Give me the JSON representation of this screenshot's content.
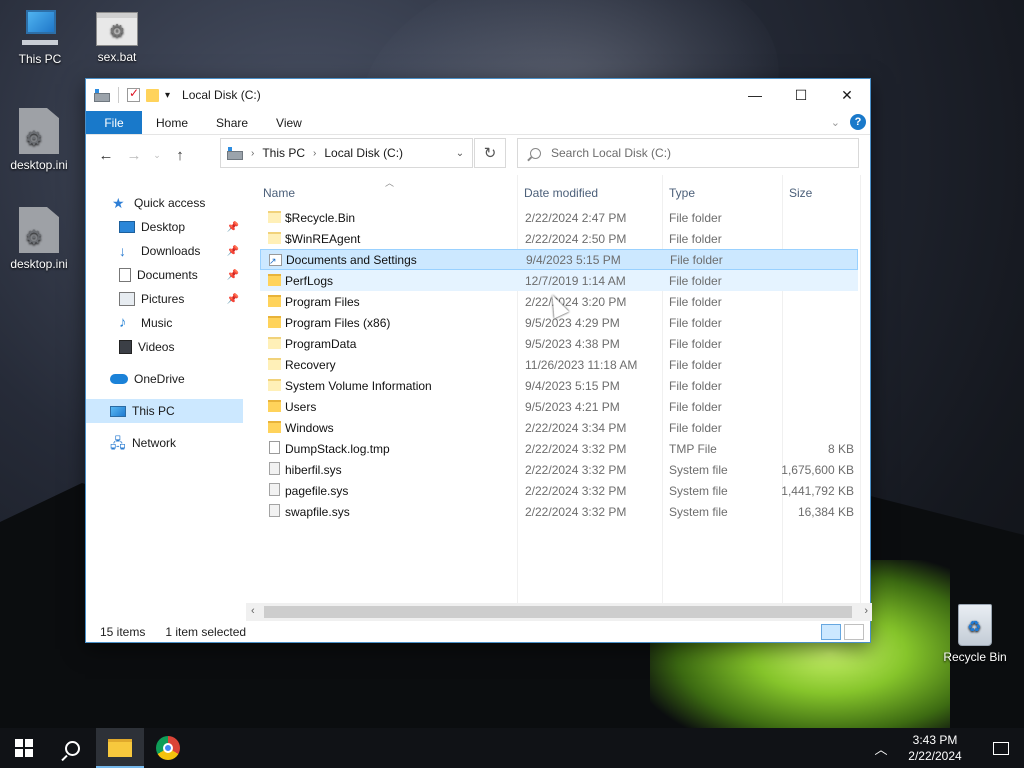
{
  "desktop": {
    "icons": [
      {
        "label": "This PC",
        "icon": "computer-icon"
      },
      {
        "label": "sex.bat",
        "icon": "batch-file-icon"
      },
      {
        "label": "desktop.ini",
        "icon": "settings-file-icon"
      },
      {
        "label": "desktop.ini",
        "icon": "settings-file-icon"
      },
      {
        "label": "Recycle Bin",
        "icon": "recycle-bin-icon"
      }
    ]
  },
  "window": {
    "title": "Local Disk (C:)",
    "controls": {
      "minimize": "—",
      "maximize": "☐",
      "close": "✕"
    }
  },
  "ribbon": {
    "tabs": [
      "File",
      "Home",
      "Share",
      "View"
    ],
    "help": "?"
  },
  "nav": {
    "address": [
      "This PC",
      "Local Disk (C:)"
    ],
    "search_placeholder": "Search Local Disk (C:)"
  },
  "sidebar": {
    "items": [
      {
        "label": "Quick access",
        "icon": "star-icon",
        "pinned": false
      },
      {
        "label": "Desktop",
        "icon": "desktop-folder-icon",
        "pinned": true
      },
      {
        "label": "Downloads",
        "icon": "download-icon",
        "pinned": true
      },
      {
        "label": "Documents",
        "icon": "documents-icon",
        "pinned": true
      },
      {
        "label": "Pictures",
        "icon": "pictures-icon",
        "pinned": true
      },
      {
        "label": "Music",
        "icon": "music-icon",
        "pinned": false
      },
      {
        "label": "Videos",
        "icon": "videos-icon",
        "pinned": false
      },
      {
        "label": "OneDrive",
        "icon": "cloud-icon",
        "pinned": false
      },
      {
        "label": "This PC",
        "icon": "computer-icon",
        "pinned": false
      },
      {
        "label": "Network",
        "icon": "network-icon",
        "pinned": false
      }
    ],
    "selected": "This PC"
  },
  "columns": {
    "name": "Name",
    "date": "Date modified",
    "type": "Type",
    "size": "Size"
  },
  "files": [
    {
      "name": "$Recycle.Bin",
      "date": "2/22/2024 2:47 PM",
      "type": "File folder",
      "size": "",
      "kind": "folder-light"
    },
    {
      "name": "$WinREAgent",
      "date": "2/22/2024 2:50 PM",
      "type": "File folder",
      "size": "",
      "kind": "folder-light"
    },
    {
      "name": "Documents and Settings",
      "date": "9/4/2023 5:15 PM",
      "type": "File folder",
      "size": "",
      "kind": "link"
    },
    {
      "name": "PerfLogs",
      "date": "12/7/2019 1:14 AM",
      "type": "File folder",
      "size": "",
      "kind": "folder"
    },
    {
      "name": "Program Files",
      "date": "2/22/2024 3:20 PM",
      "type": "File folder",
      "size": "",
      "kind": "folder"
    },
    {
      "name": "Program Files (x86)",
      "date": "9/5/2023 4:29 PM",
      "type": "File folder",
      "size": "",
      "kind": "folder"
    },
    {
      "name": "ProgramData",
      "date": "9/5/2023 4:38 PM",
      "type": "File folder",
      "size": "",
      "kind": "folder-light"
    },
    {
      "name": "Recovery",
      "date": "11/26/2023 11:18 AM",
      "type": "File folder",
      "size": "",
      "kind": "folder-light"
    },
    {
      "name": "System Volume Information",
      "date": "9/4/2023 5:15 PM",
      "type": "File folder",
      "size": "",
      "kind": "folder-light"
    },
    {
      "name": "Users",
      "date": "9/5/2023 4:21 PM",
      "type": "File folder",
      "size": "",
      "kind": "folder"
    },
    {
      "name": "Windows",
      "date": "2/22/2024 3:34 PM",
      "type": "File folder",
      "size": "",
      "kind": "folder"
    },
    {
      "name": "DumpStack.log.tmp",
      "date": "2/22/2024 3:32 PM",
      "type": "TMP File",
      "size": "8 KB",
      "kind": "file"
    },
    {
      "name": "hiberfil.sys",
      "date": "2/22/2024 3:32 PM",
      "type": "System file",
      "size": "1,675,600 KB",
      "kind": "sys"
    },
    {
      "name": "pagefile.sys",
      "date": "2/22/2024 3:32 PM",
      "type": "System file",
      "size": "1,441,792 KB",
      "kind": "sys"
    },
    {
      "name": "swapfile.sys",
      "date": "2/22/2024 3:32 PM",
      "type": "System file",
      "size": "16,384 KB",
      "kind": "sys"
    }
  ],
  "selected_file": "Documents and Settings",
  "hovered_file": "PerfLogs",
  "status": {
    "items": "15 items",
    "selection": "1 item selected"
  },
  "taskbar": {
    "apps": [
      "start-icon",
      "search-icon",
      "file-explorer-icon",
      "chrome-icon"
    ],
    "time": "3:43 PM",
    "date": "2/22/2024"
  },
  "colors": {
    "accent": "#1979ca",
    "selection": "#cce8ff",
    "hover": "#e5f3ff"
  }
}
